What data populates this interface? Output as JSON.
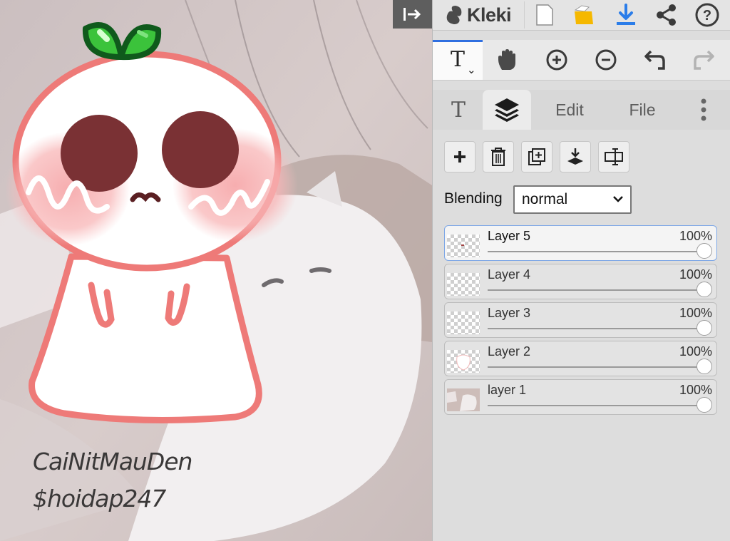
{
  "app": {
    "name": "Kleki"
  },
  "canvas": {
    "text_line_1": "CaiNitMauDen",
    "text_line_2": "$hoidap247"
  },
  "top_bar": {
    "buttons": [
      "collapse-panel",
      "new-image",
      "open-file",
      "download",
      "share",
      "help"
    ]
  },
  "toolbar": {
    "active_tool_label": "T",
    "tools": [
      "text",
      "hand",
      "zoom-in",
      "zoom-out",
      "undo",
      "redo"
    ]
  },
  "tabs": {
    "text_tab": "T",
    "edit": "Edit",
    "file": "File",
    "active": "layers"
  },
  "layer_panel": {
    "blending_label": "Blending",
    "blending_value": "normal",
    "layers": [
      {
        "name": "Layer 5",
        "opacity": "100%",
        "opacity_value": 1.0,
        "active": true
      },
      {
        "name": "Layer 4",
        "opacity": "100%",
        "opacity_value": 1.0,
        "active": false
      },
      {
        "name": "Layer 3",
        "opacity": "100%",
        "opacity_value": 1.0,
        "active": false
      },
      {
        "name": "Layer 2",
        "opacity": "100%",
        "opacity_value": 1.0,
        "active": false
      },
      {
        "name": "layer 1",
        "opacity": "100%",
        "opacity_value": 1.0,
        "active": false
      }
    ]
  },
  "colors": {
    "accent": "#2f6fe0",
    "download_icon": "#2b7de9",
    "open_icon": "#f5b800",
    "panel_bg": "#dddddd"
  }
}
